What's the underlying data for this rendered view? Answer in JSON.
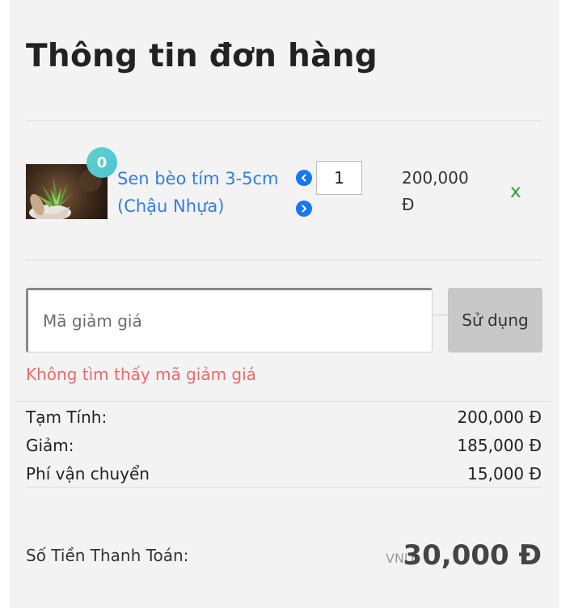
{
  "page_title": "Thông tin đơn hàng",
  "cart": {
    "item": {
      "badge_count": "0",
      "name": "Sen bèo tím 3-5cm (Chậu Nhựa)",
      "quantity": "1",
      "price": "200,000 Đ",
      "remove_label": "x"
    }
  },
  "coupon": {
    "placeholder": "Mã giảm giá",
    "value": "",
    "apply_label": "Sử dụng",
    "error": "Không tìm thấy mã giảm giá"
  },
  "summary": {
    "rows": [
      {
        "label": "Tạm Tính:",
        "value": "200,000 Đ"
      },
      {
        "label": "Giảm:",
        "value": "185,000 Đ"
      },
      {
        "label": "Phí vận chuyển",
        "value": "15,000 Đ"
      }
    ],
    "total_label": "Số Tiền Thanh Toán:",
    "currency": "VND",
    "total_value": "30,000 Đ"
  },
  "icons": {
    "decrease": "chevron-left-circle-icon",
    "increase": "chevron-right-circle-icon"
  },
  "colors": {
    "link": "#2f7ee8",
    "error": "#ec6a6a",
    "remove": "#2a9d3c",
    "badge": "#4cc3d4",
    "arrow": "#1478f0"
  }
}
